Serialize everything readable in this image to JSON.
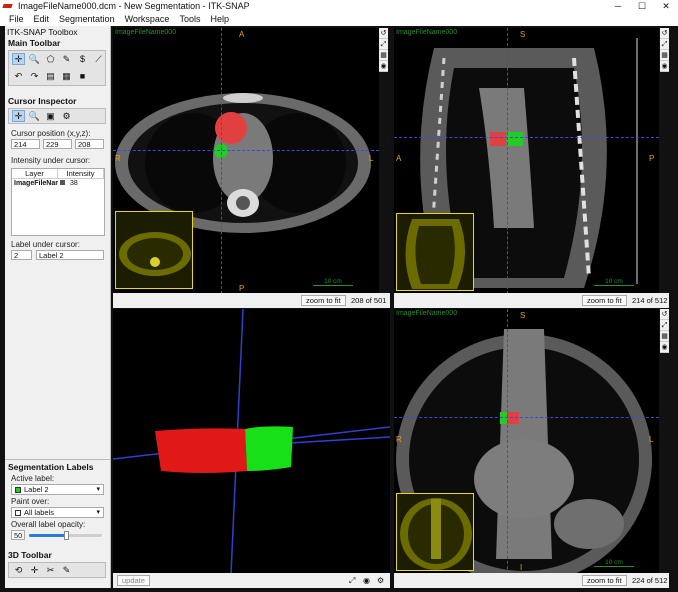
{
  "window": {
    "title": "ImageFileName000.dcm - New Segmentation - ITK-SNAP",
    "btn_min": "─",
    "btn_max": "☐",
    "btn_close": "✕"
  },
  "menu": [
    "File",
    "Edit",
    "Segmentation",
    "Workspace",
    "Tools",
    "Help"
  ],
  "toolbox": {
    "title": "ITK-SNAP Toolbox",
    "main_toolbar": "Main Toolbar",
    "cursor_inspector": "Cursor Inspector",
    "cursor_position_label": "Cursor position (x,y,z):",
    "cursor_x": "214",
    "cursor_y": "229",
    "cursor_z": "208",
    "intensity_label": "Intensity under cursor:",
    "table_headers": [
      "Layer",
      "Intensity"
    ],
    "table_rows": [
      {
        "layer": "ImageFileNam...",
        "intensity": "38"
      }
    ],
    "label_under_cursor": "Label under cursor:",
    "label_id": "2",
    "label_name": "Label 2",
    "seg_labels": "Segmentation Labels",
    "active_label_caption": "Active label:",
    "active_label": "Label 2",
    "paint_over_caption": "Paint over:",
    "paint_over": "All labels",
    "opacity_caption": "Overall label opacity:",
    "opacity": "50",
    "opacity_fraction": 0.5,
    "toolbar3d": "3D Toolbar"
  },
  "views": {
    "axial": {
      "name": "ImageFileName000",
      "top": "A",
      "bottom": "P",
      "left": "R",
      "right": "L",
      "zoom": "zoom to fit",
      "slice": "208 of 501",
      "scale": "10 cm"
    },
    "sagittal": {
      "name": "ImageFileName000",
      "top": "S",
      "left": "A",
      "right": "P",
      "zoom": "zoom to fit",
      "slice": "214 of 512",
      "scale": "10 cm"
    },
    "coronal": {
      "name": "ImageFileName000",
      "top": "S",
      "left": "R",
      "right": "L",
      "bottom": "I",
      "zoom": "zoom to fit",
      "slice": "224 of 512",
      "scale": "10 cm"
    },
    "render3d": {
      "update": "update"
    }
  },
  "colors": {
    "label_red": "#e02020",
    "label_green": "#22cc22",
    "crosshair": "#3b4bd6",
    "orientation": "#e8a020"
  }
}
